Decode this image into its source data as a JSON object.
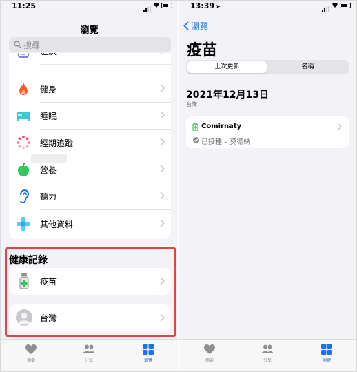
{
  "left": {
    "status": {
      "time": "11:25"
    },
    "nav_title": "瀏覽",
    "search": {
      "placeholder": "搜尋"
    },
    "categories": [
      {
        "label": "症狀",
        "icon": "symptoms-icon"
      },
      {
        "label": "健身",
        "icon": "flame-icon"
      },
      {
        "label": "睡眠",
        "icon": "bed-icon"
      },
      {
        "label": "經期追蹤",
        "icon": "cycle-icon"
      },
      {
        "label": "營養",
        "icon": "apple-icon"
      },
      {
        "label": "聽力",
        "icon": "ear-icon"
      },
      {
        "label": "其他資料",
        "icon": "plus-icon"
      }
    ],
    "records_section": {
      "title": "健康記錄",
      "items": [
        {
          "label": "疫苗",
          "icon": "vaccine-vial-icon"
        },
        {
          "label": "台灣",
          "icon": "avatar-icon"
        }
      ]
    },
    "tabbar": [
      {
        "label": "摘要",
        "icon": "heart-icon",
        "active": false
      },
      {
        "label": "分享",
        "icon": "people-icon",
        "active": false
      },
      {
        "label": "瀏覽",
        "icon": "grid-icon",
        "active": true
      }
    ]
  },
  "right": {
    "status": {
      "time": "13:39"
    },
    "back_label": "瀏覽",
    "title": "疫苗",
    "segments": {
      "first": "上次更新",
      "second": "名稱"
    },
    "date_heading": "2021年12月13日",
    "region": "台灣",
    "vaccine": {
      "name": "Comirnaty",
      "status": "已接種 – 莫德納"
    },
    "tabbar": [
      {
        "label": "摘要",
        "icon": "heart-icon",
        "active": false
      },
      {
        "label": "分享",
        "icon": "people-icon",
        "active": false
      },
      {
        "label": "瀏覽",
        "icon": "grid-icon",
        "active": true
      }
    ]
  },
  "colors": {
    "accent": "#1a73e8",
    "highlight_border": "#e04444",
    "background": "#f2f2f7",
    "fitness": "#ff5a2c",
    "sleep": "#3ec8d2",
    "nutrition": "#34c759",
    "hearing": "#1a73e8",
    "other": "#5ac8fa",
    "vaccine": "#34c759"
  }
}
